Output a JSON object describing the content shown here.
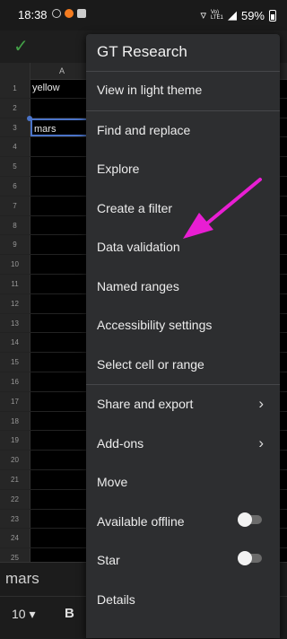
{
  "status_bar": {
    "time": "18:38",
    "battery": "59%",
    "network": "Vo) LTE1"
  },
  "sheet": {
    "column_header": "A",
    "rows": [
      "1",
      "2",
      "3",
      "4",
      "5",
      "6",
      "7",
      "8",
      "9",
      "10",
      "11",
      "12",
      "13",
      "14",
      "15",
      "16",
      "17",
      "18",
      "19",
      "20",
      "21",
      "22",
      "23",
      "24",
      "25"
    ],
    "cells": {
      "1": "yellow",
      "3": "mars"
    }
  },
  "formula_bar": {
    "value": "mars"
  },
  "format_bar": {
    "font_size": "10",
    "bold_label": "B"
  },
  "menu": {
    "title": "GT Research",
    "items": [
      {
        "label": "View in light theme"
      },
      {
        "label": "Find and replace"
      },
      {
        "label": "Explore"
      },
      {
        "label": "Create a filter"
      },
      {
        "label": "Data validation"
      },
      {
        "label": "Named ranges"
      },
      {
        "label": "Accessibility settings"
      },
      {
        "label": "Select cell or range"
      },
      {
        "label": "Share and export"
      },
      {
        "label": "Add-ons"
      },
      {
        "label": "Move"
      },
      {
        "label": "Available offline"
      },
      {
        "label": "Star"
      },
      {
        "label": "Details"
      }
    ]
  },
  "annotation": {
    "color": "#e81ed3"
  }
}
